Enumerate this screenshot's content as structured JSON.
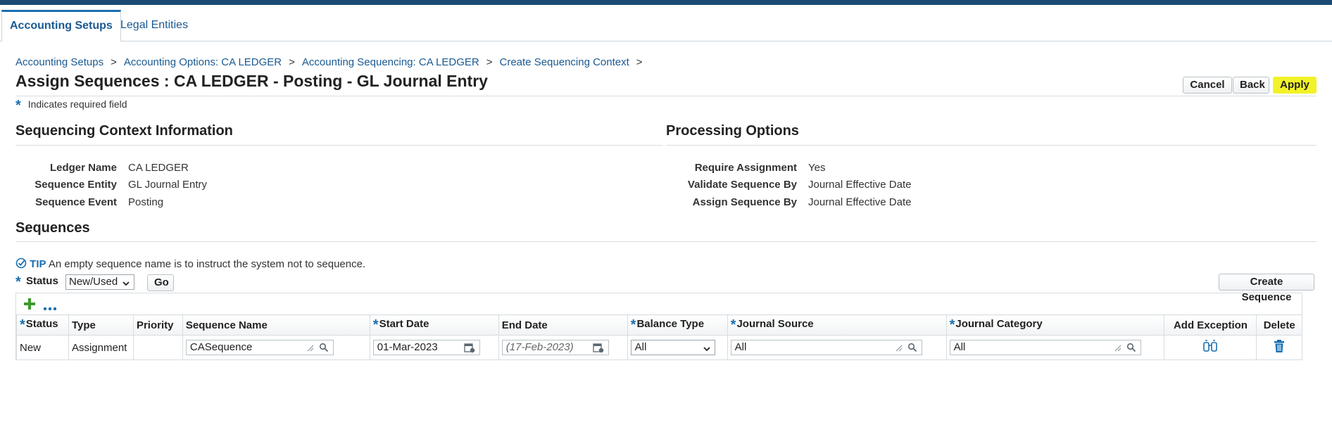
{
  "tabs": [
    "Accounting Setups",
    "Legal Entities"
  ],
  "breadcrumbs": [
    "Accounting Setups",
    "Accounting Options: CA LEDGER",
    "Accounting Sequencing: CA LEDGER",
    "Create Sequencing Context"
  ],
  "crumb_sep": ">",
  "page_title": "Assign Sequences : CA LEDGER - Posting - GL Journal Entry",
  "buttons": {
    "cancel": "Cancel",
    "back": "Back",
    "apply": "Apply",
    "go": "Go",
    "create_sequence": "Create Sequence"
  },
  "required_note": {
    "star": "*",
    "text": "Indicates required field"
  },
  "context": {
    "title": "Sequencing Context Information",
    "fields": [
      {
        "label": "Ledger Name",
        "value": "CA LEDGER"
      },
      {
        "label": "Sequence Entity",
        "value": "GL Journal Entry"
      },
      {
        "label": "Sequence Event",
        "value": "Posting"
      }
    ]
  },
  "processing": {
    "title": "Processing Options",
    "fields": [
      {
        "label": "Require Assignment",
        "value": "Yes"
      },
      {
        "label": "Validate Sequence By",
        "value": "Journal Effective Date"
      },
      {
        "label": "Assign Sequence By",
        "value": "Journal Effective Date"
      }
    ]
  },
  "sequences": {
    "title": "Sequences",
    "tip_word": "TIP",
    "tip_text": "An empty sequence name is to instruct the system not to sequence.",
    "status_label": "Status",
    "status_value": "New/Used",
    "columns": [
      "Status",
      "Type",
      "Priority",
      "Sequence Name",
      "Start Date",
      "End Date",
      "Balance Type",
      "Journal Source",
      "Journal Category",
      "Add Exception",
      "Delete"
    ],
    "required_columns": [
      true,
      false,
      false,
      false,
      true,
      false,
      true,
      true,
      true,
      false,
      false
    ],
    "row": {
      "status": "New",
      "type": "Assignment",
      "priority": "",
      "sequence_name": "CASequence",
      "start_date": "01-Mar-2023",
      "end_date": "(17-Feb-2023)",
      "balance_type": "All",
      "journal_source": "All",
      "journal_category": "All"
    }
  },
  "colors": {
    "accent": "#1a6fb0",
    "topbar": "#1b4a72",
    "apply_highlight": "#f1f228",
    "add_icon": "#3a9a2a"
  }
}
